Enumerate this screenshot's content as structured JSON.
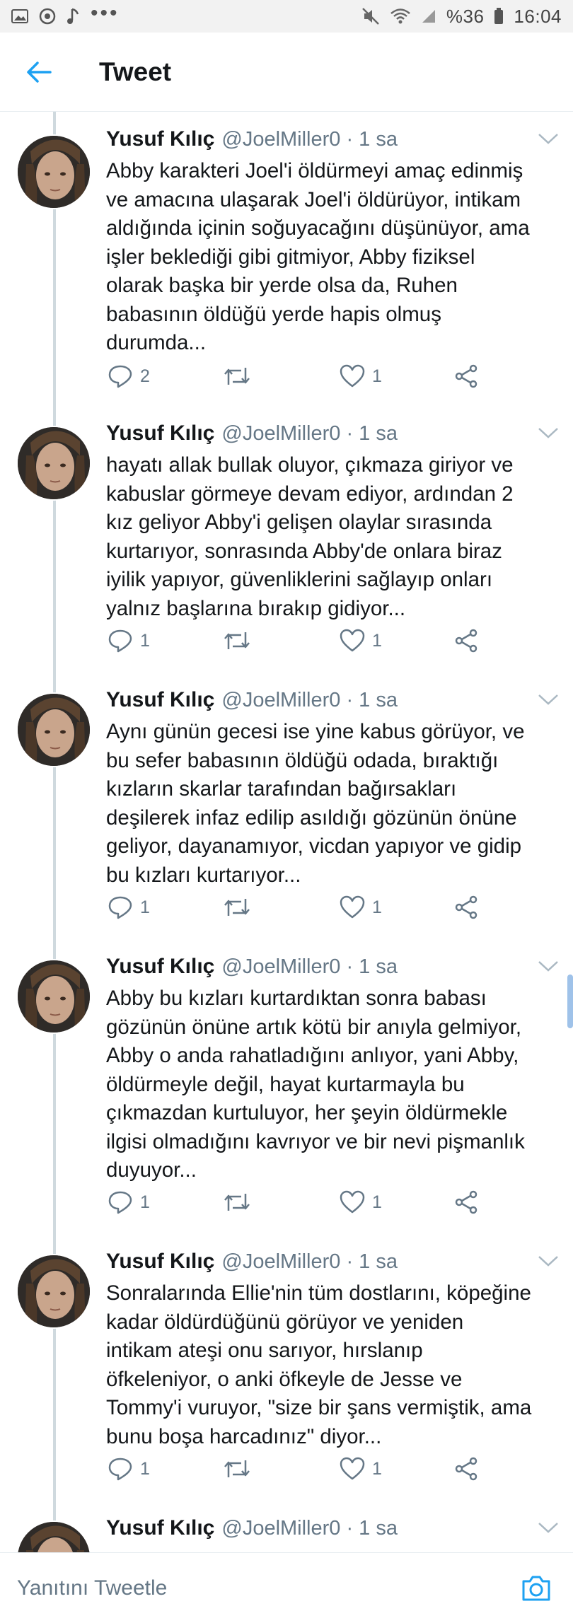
{
  "status_bar": {
    "battery_text": "%36",
    "time": "16:04",
    "overflow": "•••"
  },
  "header": {
    "title": "Tweet"
  },
  "tweets": [
    {
      "name": "Yusuf Kılıç",
      "meta": "@JoelMiller0 · 1 sa",
      "lines": [
        "Abby karakteri Joel'i öldürmeyi amaç edinmiş",
        "ve amacına ulaşarak Joel'i öldürüyor, intikam",
        "aldığında içinin soğuyacağını düşünüyor, ama",
        "işler beklediği gibi gitmiyor, Abby fiziksel",
        "olarak başka bir yerde olsa da, Ruhen",
        "babasının öldüğü yerde hapis olmuş",
        "durumda..."
      ],
      "replies": "2",
      "likes": "1"
    },
    {
      "name": "Yusuf Kılıç",
      "meta": "@JoelMiller0 · 1 sa",
      "lines": [
        "hayatı allak bullak oluyor, çıkmaza giriyor ve",
        "kabuslar görmeye devam ediyor, ardından 2",
        "kız geliyor Abby'i gelişen olaylar sırasında",
        "kurtarıyor, sonrasında Abby'de onlara biraz",
        "iyilik yapıyor, güvenliklerini sağlayıp onları",
        "yalnız başlarına bırakıp gidiyor..."
      ],
      "replies": "1",
      "likes": "1"
    },
    {
      "name": "Yusuf Kılıç",
      "meta": "@JoelMiller0 · 1 sa",
      "lines": [
        "Aynı günün gecesi ise yine kabus görüyor, ve",
        "bu sefer babasının öldüğü odada, bıraktığı",
        "kızların skarlar tarafından bağırsakları",
        "deşilerek infaz edilip asıldığı gözünün önüne",
        "geliyor, dayanamıyor, vicdan yapıyor ve gidip",
        "bu kızları kurtarıyor..."
      ],
      "replies": "1",
      "likes": "1"
    },
    {
      "name": "Yusuf Kılıç",
      "meta": "@JoelMiller0 · 1 sa",
      "lines": [
        "Abby bu kızları kurtardıktan sonra babası",
        "gözünün önüne artık kötü bir anıyla gelmiyor,",
        "Abby o anda rahatladığını anlıyor, yani Abby,",
        "öldürmeyle değil, hayat kurtarmayla bu",
        "çıkmazdan kurtuluyor, her şeyin öldürmekle",
        "ilgisi olmadığını kavrıyor ve bir nevi pişmanlık",
        "duyuyor..."
      ],
      "replies": "1",
      "likes": "1"
    },
    {
      "name": "Yusuf Kılıç",
      "meta": "@JoelMiller0 · 1 sa",
      "lines": [
        "Sonralarında Ellie'nin tüm dostlarını, köpeğine",
        "kadar öldürdüğünü görüyor ve yeniden",
        "intikam ateşi onu sarıyor, hırslanıp",
        "öfkeleniyor, o anki öfkeyle de Jesse ve",
        "Tommy'i vuruyor, \"size bir şans vermiştik, ama",
        "bunu boşa harcadınız\" diyor..."
      ],
      "replies": "1",
      "likes": "1"
    },
    {
      "name": "Yusuf Kılıç",
      "meta": "@JoelMiller0 · 1 sa",
      "lines": [],
      "replies": "",
      "likes": ""
    }
  ],
  "reply_bar": {
    "placeholder": "Yanıtını Tweetle"
  },
  "colors": {
    "accent": "#1da1f2",
    "secondary_text": "#657786",
    "thread_line": "#cfd9de"
  },
  "icons": {
    "reply": "reply-icon",
    "retweet": "retweet-icon",
    "like": "like-icon",
    "share": "share-icon",
    "back": "back-arrow-icon",
    "camera": "camera-icon"
  }
}
